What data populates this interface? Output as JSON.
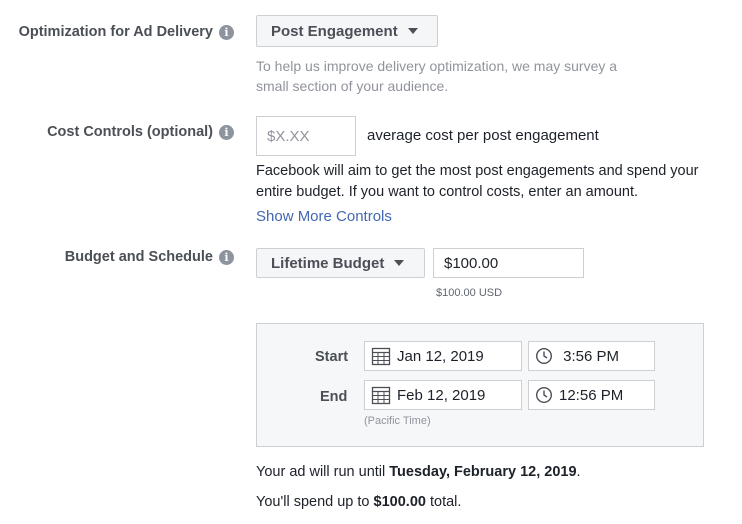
{
  "optimization": {
    "label": "Optimization for Ad Delivery",
    "info": "i",
    "selected": "Post Engagement",
    "help_line1": "To help us improve delivery optimization, we may survey a",
    "help_line2": "small section of your audience."
  },
  "cost_controls": {
    "label": "Cost Controls (optional)",
    "info": "i",
    "placeholder": "$X.XX",
    "suffix": "average cost per post engagement",
    "desc_line1": "Facebook will aim to get the most post engagements and spend your",
    "desc_line2": "entire budget. If you want to control costs, enter an amount.",
    "more_link": "Show More Controls"
  },
  "budget": {
    "label": "Budget and Schedule",
    "info": "i",
    "type": "Lifetime Budget",
    "amount": "$100.00",
    "amount_note": "$100.00 USD"
  },
  "schedule": {
    "start_label": "Start",
    "start_date": "Jan 12, 2019",
    "start_time": " 3:56 PM",
    "end_label": "End",
    "end_date": "Feb 12, 2019",
    "end_time": "12:56 PM",
    "timezone": "(Pacific Time)"
  },
  "summary": {
    "run_prefix": "Your ad will run until ",
    "run_date": "Tuesday, February 12, 2019",
    "run_suffix": ".",
    "spend_prefix": "You'll spend up to ",
    "spend_amount": "$100.00",
    "spend_suffix": " total."
  },
  "icons": {
    "info": "info-icon",
    "calendar": "calendar-icon",
    "clock": "clock-icon",
    "caret": "chevron-down-icon"
  },
  "colors": {
    "link": "#4267b2",
    "label": "#4b4f56",
    "muted": "#90949c"
  }
}
